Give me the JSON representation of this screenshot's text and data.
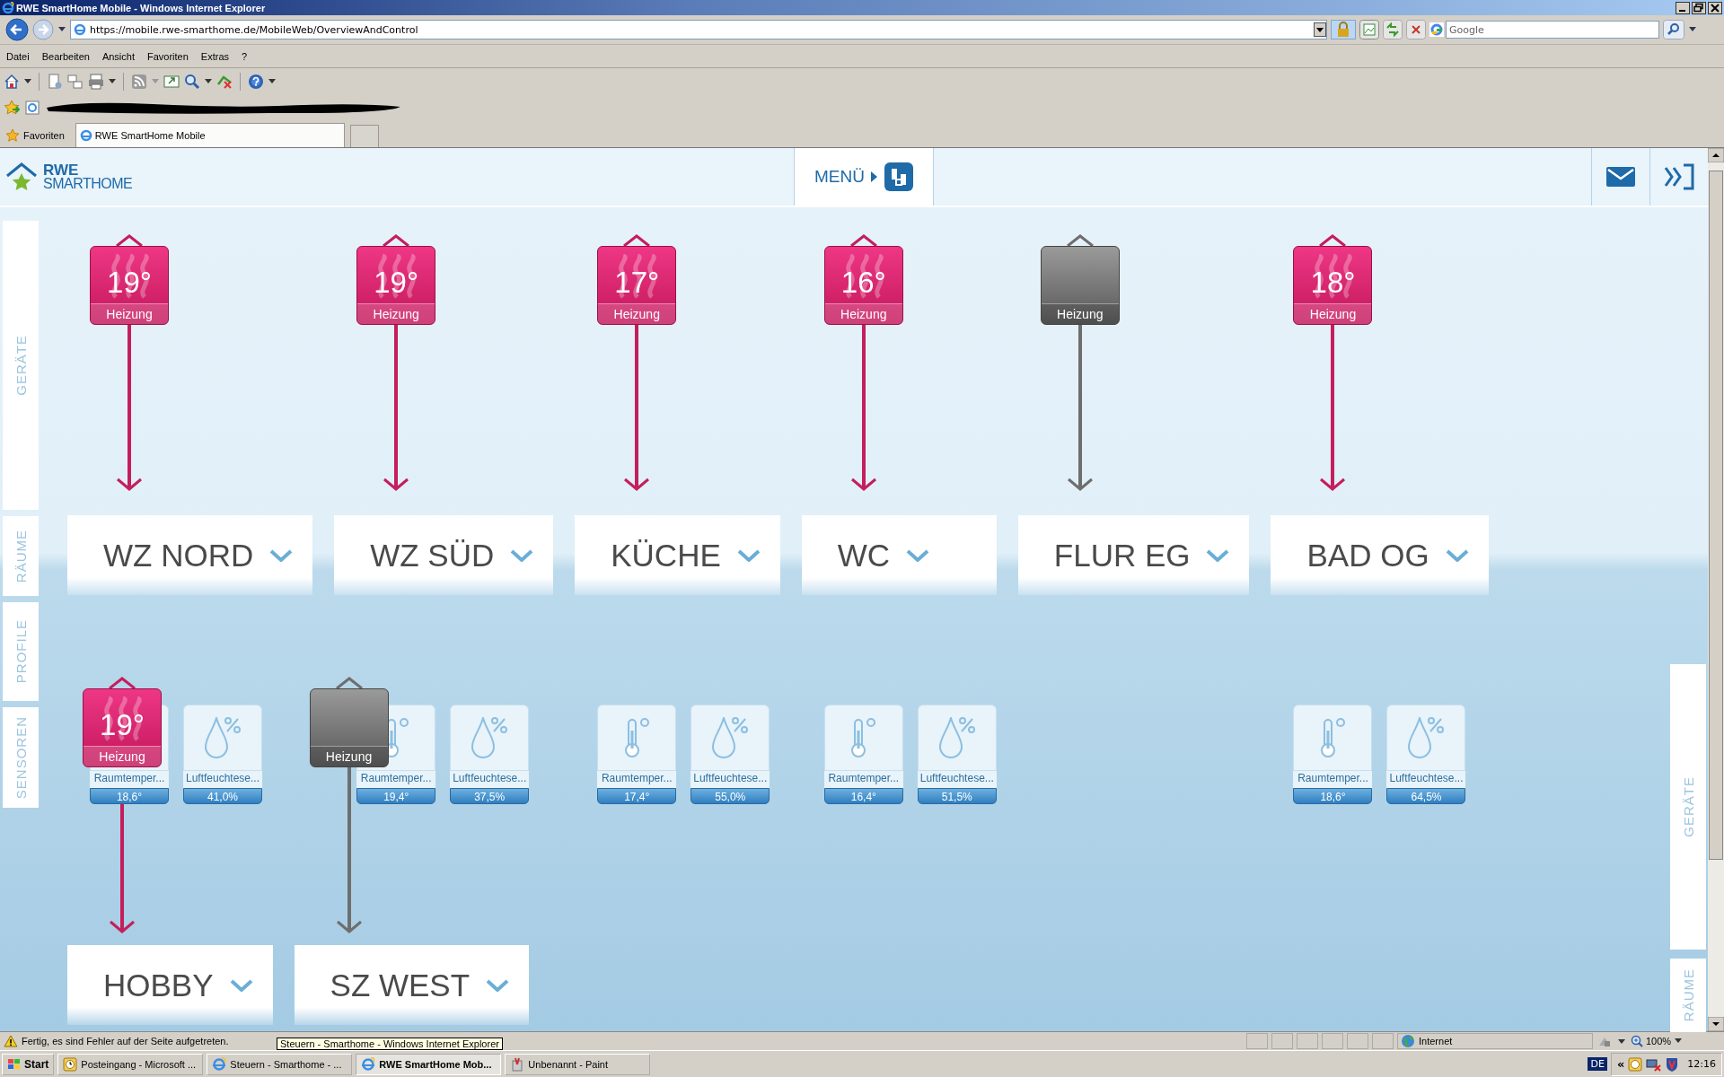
{
  "browser": {
    "title": "RWE SmartHome Mobile - Windows Internet Explorer",
    "address": "https://mobile.rwe-smarthome.de/MobileWeb/OverviewAndControl",
    "search_placeholder": "Google",
    "menu": [
      "Datei",
      "Bearbeiten",
      "Ansicht",
      "Favoriten",
      "Extras",
      "?"
    ],
    "favorites_label": "Favoriten",
    "tabs": [
      {
        "label": "RWE SmartHome Mobile",
        "selected": true
      }
    ]
  },
  "app": {
    "logo_top": "RWE",
    "logo_bottom": "SMARTHOME",
    "menu_button": "MENÜ",
    "left_tabs": [
      {
        "label": "GERÄTE",
        "kind": "devices"
      },
      {
        "label": "RÄUME",
        "kind": "rooms"
      },
      {
        "label": "PROFILE",
        "kind": "profiles"
      },
      {
        "label": "SENSOREN",
        "kind": "sensors"
      }
    ],
    "right_tabs": [
      {
        "label": "GERÄTE",
        "kind": "devices"
      },
      {
        "label": "RÄUME",
        "kind": "rooms"
      }
    ]
  },
  "rooms": [
    {
      "name": "WZ NORD",
      "heater": {
        "on": true,
        "temperature": "19°",
        "label": "Heizung"
      },
      "sensors": [
        {
          "kind": "temperature",
          "label": "Raumtemper...",
          "value": "18,6°"
        },
        {
          "kind": "humidity",
          "label": "Luftfeuchtese...",
          "value": "41,0%"
        }
      ]
    },
    {
      "name": "WZ SÜD",
      "heater": {
        "on": true,
        "temperature": "19°",
        "label": "Heizung"
      },
      "sensors": [
        {
          "kind": "temperature",
          "label": "Raumtemper...",
          "value": "19,4°"
        },
        {
          "kind": "humidity",
          "label": "Luftfeuchtese...",
          "value": "37,5%"
        }
      ]
    },
    {
      "name": "KÜCHE",
      "heater": {
        "on": true,
        "temperature": "17°",
        "label": "Heizung"
      },
      "sensors": [
        {
          "kind": "temperature",
          "label": "Raumtemper...",
          "value": "17,4°"
        },
        {
          "kind": "humidity",
          "label": "Luftfeuchtese...",
          "value": "55,0%"
        }
      ]
    },
    {
      "name": "WC",
      "heater": {
        "on": true,
        "temperature": "16°",
        "label": "Heizung"
      },
      "sensors": [
        {
          "kind": "temperature",
          "label": "Raumtemper...",
          "value": "16,4°"
        },
        {
          "kind": "humidity",
          "label": "Luftfeuchtese...",
          "value": "51,5%"
        }
      ]
    },
    {
      "name": "FLUR EG",
      "heater": {
        "on": false,
        "label": "Heizung"
      }
    },
    {
      "name": "BAD OG",
      "heater": {
        "on": true,
        "temperature": "18°",
        "label": "Heizung"
      },
      "sensors": [
        {
          "kind": "temperature",
          "label": "Raumtemper...",
          "value": "18,6°"
        },
        {
          "kind": "humidity",
          "label": "Luftfeuchtese...",
          "value": "64,5%"
        }
      ]
    }
  ],
  "lower_rooms": [
    {
      "name": "HOBBY",
      "heater": {
        "on": true,
        "temperature": "19°",
        "label": "Heizung"
      }
    },
    {
      "name": "SZ WEST",
      "heater": {
        "on": false,
        "label": "Heizung"
      }
    }
  ],
  "status_bar": {
    "message": "Fertig, es sind Fehler auf der Seite aufgetreten.",
    "tooltip": "Steuern - Smarthome - Windows Internet Explorer",
    "zone": "Internet",
    "zoom": "100%"
  },
  "taskbar": {
    "start": "Start",
    "tasks": [
      {
        "label": "Posteingang - Microsoft ...",
        "selected": false,
        "kind": "clock"
      },
      {
        "label": "Steuern - Smarthome - ...",
        "selected": false,
        "kind": "browser"
      },
      {
        "label": "RWE SmartHome Mob...",
        "selected": true,
        "kind": "browser"
      },
      {
        "label": "Unbenannt - Paint",
        "selected": false,
        "kind": "paint"
      }
    ],
    "language": "DE",
    "tray_toggle": "«",
    "clock": "12:16"
  }
}
